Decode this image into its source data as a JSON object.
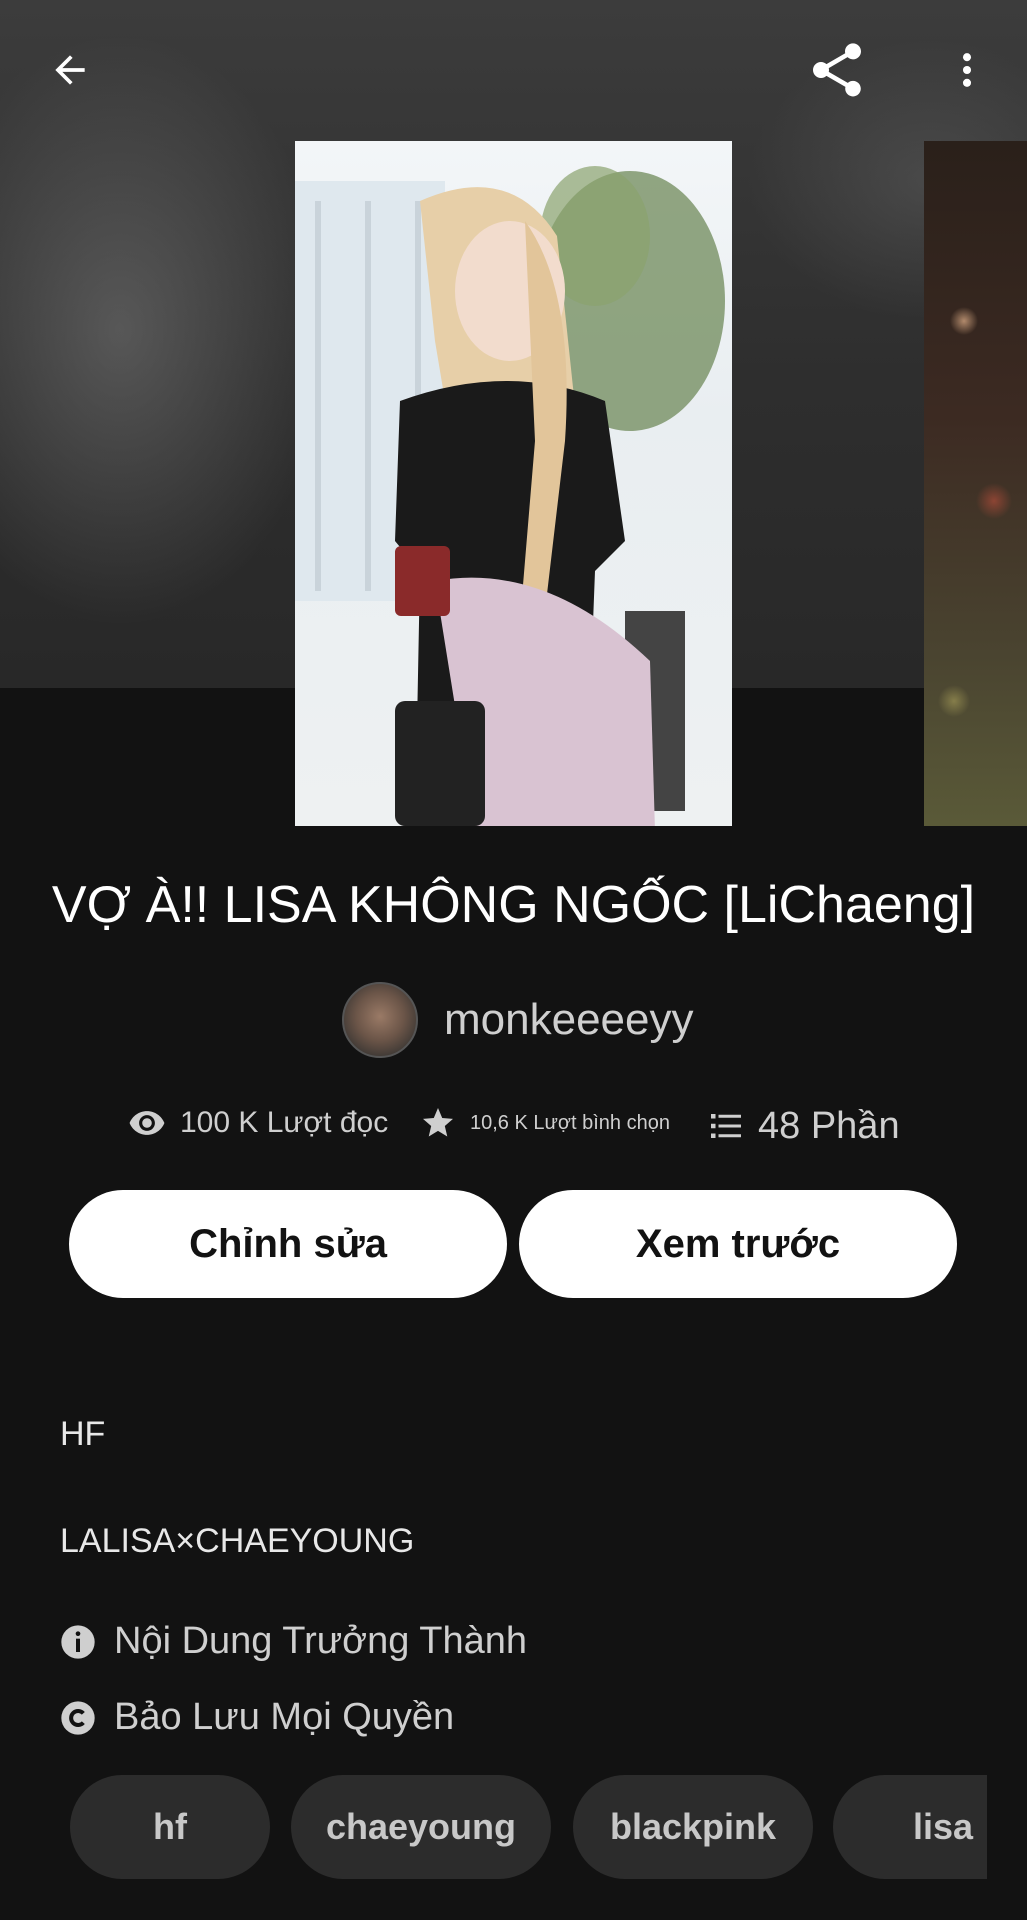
{
  "header": {
    "back_icon": "back-arrow-icon",
    "share_icon": "share-icon",
    "more_icon": "more-vertical-icon"
  },
  "story": {
    "title": "VỢ À!! LISA KHÔNG NGỐC [LiChaeng]",
    "author": "monkeeeeyy"
  },
  "stats": {
    "reads": "100 K Lượt đọc",
    "votes": "10,6 K Lượt bình chọn",
    "parts": "48 Phần"
  },
  "actions": {
    "edit_label": "Chỉnh sửa",
    "preview_label": "Xem trước"
  },
  "description": {
    "line1": "HF",
    "line2": "LALISA×CHAEYOUNG"
  },
  "meta": {
    "mature": "Nội Dung Trưởng Thành",
    "copyright": "Bảo Lưu Mọi Quyền"
  },
  "tags": [
    "hf",
    "chaeyoung",
    "blackpink",
    "lisa"
  ],
  "colors": {
    "background": "#121212",
    "button_bg": "#ffffff",
    "tag_bg": "#2c2c2c",
    "muted_text": "#cfcfcf"
  }
}
